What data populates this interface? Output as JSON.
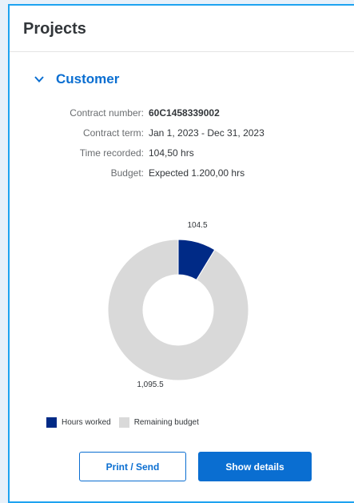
{
  "header": {
    "title": "Projects"
  },
  "section": {
    "title": "Customer",
    "icon": "chevron-down-icon"
  },
  "details": [
    {
      "label": "Contract number:",
      "value": "60C1458339002",
      "bold": true
    },
    {
      "label": "Contract term:",
      "value": "Jan 1, 2023 - Dec 31, 2023",
      "bold": false
    },
    {
      "label": "Time recorded:",
      "value": "104,50 hrs",
      "bold": false
    },
    {
      "label": "Budget:",
      "value": "Expected 1.200,00 hrs",
      "bold": false
    }
  ],
  "chart_data": {
    "type": "pie",
    "donut": true,
    "slices": [
      {
        "name": "Hours worked",
        "value": 104.5,
        "label": "104.5",
        "color": "#002a86"
      },
      {
        "name": "Remaining budget",
        "value": 1095.5,
        "label": "1,095.5",
        "color": "#d9d9d9"
      }
    ],
    "legend_position": "bottom-left"
  },
  "legend": [
    {
      "label": "Hours worked",
      "color": "#002a86"
    },
    {
      "label": "Remaining budget",
      "color": "#d9d9d9"
    }
  ],
  "actions": {
    "print_send": "Print / Send",
    "show_details": "Show details"
  },
  "colors": {
    "accent": "#0a6ed1",
    "focus_border": "#1ea3f0"
  }
}
